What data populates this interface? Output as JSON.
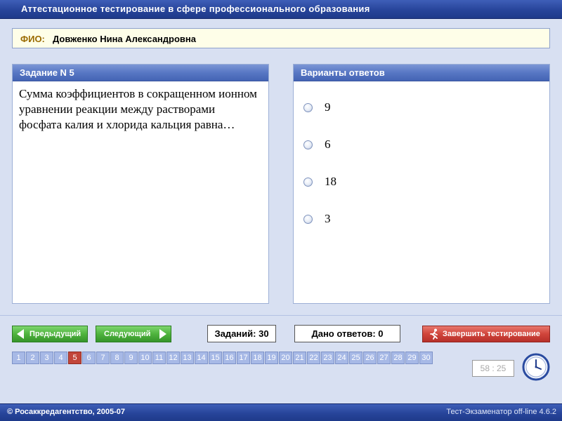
{
  "window": {
    "title": "Аттестационное тестирование в сфере профессионального образования"
  },
  "fio": {
    "label": "ФИО:",
    "value": "Довженко Нина Александровна"
  },
  "task": {
    "header": "Задание N 5",
    "question": "Сумма коэффициентов в сокращенном ионном уравнении реакции между растворами фосфата калия и хлорида кальция равна…"
  },
  "answers": {
    "header": "Варианты ответов",
    "options": [
      "9",
      "6",
      "18",
      "3"
    ]
  },
  "controls": {
    "prev_label": "Предыдущий",
    "next_label": "Следующий",
    "total_label": "Заданий: 30",
    "answered_label": "Дано ответов: 0",
    "finish_label": "Завершить тестирование"
  },
  "questions": {
    "numbers": [
      "1",
      "2",
      "3",
      "4",
      "5",
      "6",
      "7",
      "8",
      "9",
      "10",
      "11",
      "12",
      "13",
      "14",
      "15",
      "16",
      "17",
      "18",
      "19",
      "20",
      "21",
      "22",
      "23",
      "24",
      "25",
      "26",
      "27",
      "28",
      "29",
      "30"
    ],
    "current": "5"
  },
  "timer": {
    "value": "58 : 25"
  },
  "footer": {
    "copyright": "© Росаккредагентство, 2005-07",
    "version": "Тест-Экзаменатор off-line 4.6.2"
  },
  "colors": {
    "title_bar": "#27449a",
    "panel_header": "#5877c4",
    "nav_button": "#4fb33e",
    "finish_button": "#d0453b",
    "question_cell": "#a7b9e6",
    "question_cell_active": "#c2463b"
  },
  "icons": {
    "finish": "running-man-icon",
    "timer": "clock-icon"
  }
}
